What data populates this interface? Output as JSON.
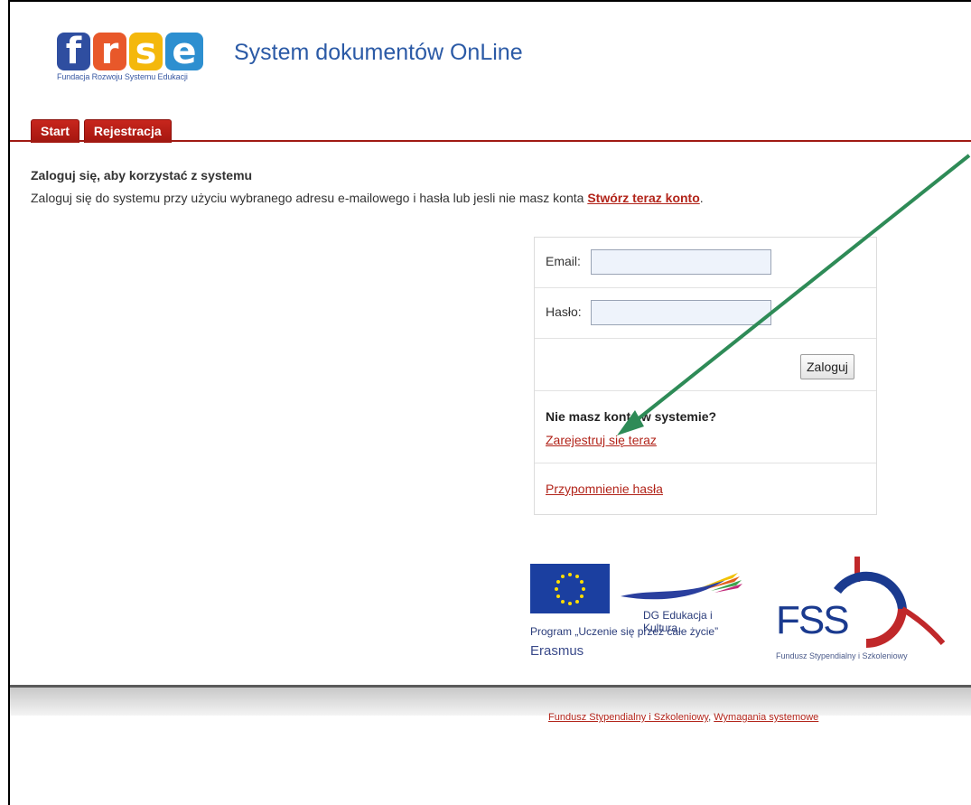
{
  "header": {
    "logo_letters": [
      "f",
      "r",
      "s",
      "e"
    ],
    "logo_subtitle": "Fundacja Rozwoju Systemu Edukacji",
    "app_title": "System dokumentów OnLine"
  },
  "tabs": [
    {
      "label": "Start"
    },
    {
      "label": "Rejestracja"
    }
  ],
  "intro": {
    "title": "Zaloguj się, aby korzystać z systemu",
    "text_before": "Zaloguj się do systemu przy użyciu wybranego adresu e-mailowego i hasła lub jesli nie masz konta ",
    "link": "Stwórz teraz konto",
    "text_after": "."
  },
  "login": {
    "email_label": "Email:",
    "email_value": "",
    "password_label": "Hasło:",
    "password_value": "",
    "submit_label": "Zaloguj",
    "no_account_question": "Nie masz konta w systemie?",
    "register_link": "Zarejestruj się teraz",
    "reminder_link": "Przypomnienie hasła"
  },
  "partners": {
    "eu_dg": "DG Edukacja i Kultura",
    "eu_program": "Program „Uczenie się przez całe życie”",
    "eu_erasmus": "Erasmus",
    "fss_letters": "FSS",
    "fss_subtitle": "Fundusz Stypendialny i Szkoleniowy"
  },
  "footer": {
    "link1": "Fundusz Stypendialny i Szkoleniowy",
    "separator": ", ",
    "link2": "Wymagania systemowe"
  },
  "colors": {
    "accent_red": "#b2241a",
    "title_blue": "#2b5aa6",
    "annotation_arrow": "#2e8b57"
  }
}
